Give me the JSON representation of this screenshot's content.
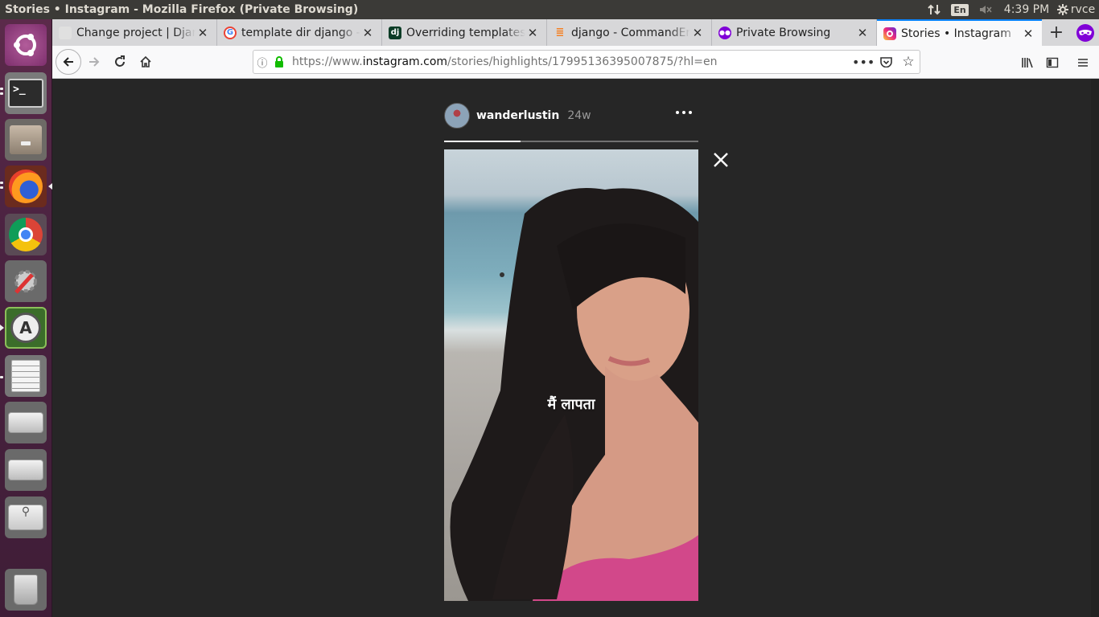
{
  "window": {
    "title": "Stories • Instagram - Mozilla Firefox (Private Browsing)"
  },
  "system": {
    "keyboard": "En",
    "time": "4:39 PM",
    "user": "rvce"
  },
  "launcher": {
    "items": [
      "ubuntu-dash-icon",
      "terminal-icon",
      "file-manager-icon",
      "firefox-icon",
      "chrome-icon",
      "system-settings-icon",
      "software-updater-icon",
      "text-editor-icon",
      "disk-drive-icon",
      "disk-drive-icon",
      "usb-drive-icon",
      "trash-icon"
    ]
  },
  "tabs": [
    {
      "label": "Change project | Django site admin",
      "icon": "django-admin-favicon"
    },
    {
      "label": "template dir django - Google Search",
      "icon": "google-favicon"
    },
    {
      "label": "Overriding templates | Django documentation",
      "icon": "django-docs-favicon"
    },
    {
      "label": "django - CommandError",
      "icon": "stackoverflow-favicon"
    },
    {
      "label": "Private Browsing",
      "icon": "private-mask-favicon"
    },
    {
      "label": "Stories • Instagram",
      "icon": "instagram-favicon"
    }
  ],
  "url": {
    "prefix": "https://www.",
    "domain": "instagram.com",
    "path": "/stories/highlights/17995136395007875/?hl=en"
  },
  "story": {
    "username": "wanderlustin",
    "age": "24w",
    "caption": "मैं  लापता",
    "progress": 0.3
  },
  "colors": {
    "accent": "#0a84ff",
    "launcher": "#4a2240",
    "private": "#8000d7"
  }
}
